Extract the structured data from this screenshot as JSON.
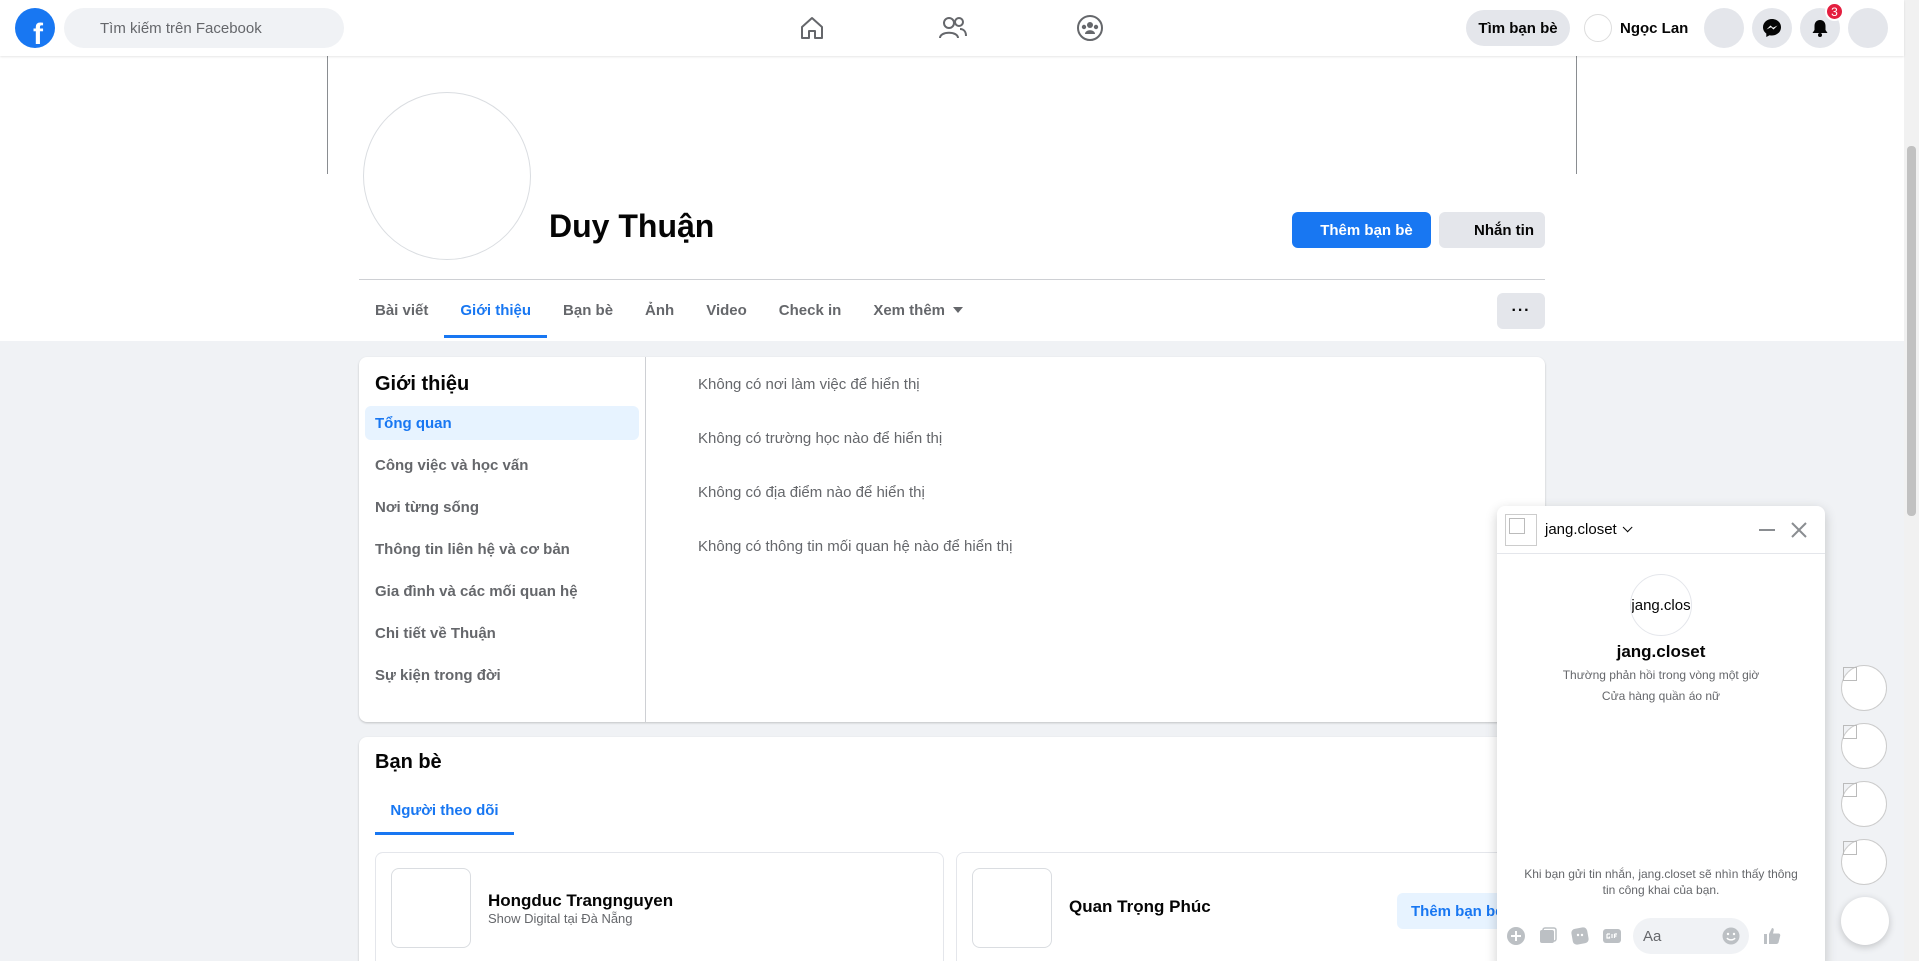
{
  "topbar": {
    "logo": "f",
    "search_placeholder": "Tìm kiếm trên Facebook",
    "nav_icons": [
      "home-icon",
      "friends-icon",
      "groups-icon"
    ],
    "find_friends_label": "Tìm bạn bè",
    "user_name": "Ngọc Lan",
    "notification_count": "3"
  },
  "profile": {
    "name": "Duy Thuận",
    "add_friend_label": "Thêm bạn bè",
    "message_label": "Nhắn tin",
    "tabs": [
      "Bài viết",
      "Giới thiệu",
      "Bạn bè",
      "Ảnh",
      "Video",
      "Check in",
      "Xem thêm"
    ],
    "active_tab": "Giới thiệu",
    "more_label": "···"
  },
  "about": {
    "title": "Giới thiệu",
    "menu": [
      "Tổng quan",
      "Công việc và học vấn",
      "Nơi từng sống",
      "Thông tin liên hệ và cơ bản",
      "Gia đình và các mối quan hệ",
      "Chi tiết về Thuận",
      "Sự kiện trong đời"
    ],
    "active_item": "Tổng quan",
    "lines": [
      "Không có nơi làm việc để hiển thị",
      "Không có trường học nào để hiển thị",
      "Không có địa điểm nào để hiển thị",
      "Không có thông tin mối quan hệ nào để hiển thị"
    ]
  },
  "friends": {
    "title": "Bạn bè",
    "tab": "Người theo dõi",
    "items": [
      {
        "name": "Hongduc Trangnguyen",
        "sub": "Show Digital tại Đà Nẵng"
      },
      {
        "name": "Quan Trọng Phúc",
        "button": "Thêm bạn bè"
      }
    ]
  },
  "chat": {
    "name": "jang.closet",
    "avatar_text": "jang.clos",
    "title": "jang.closet",
    "response": "Thường phản hồi trong vòng một giờ",
    "category": "Cửa hàng quần áo nữ",
    "note": "Khi bạn gửi tin nhắn, jang.closet sẽ nhìn thấy thông tin công khai của bạn.",
    "input_placeholder": "Aa"
  },
  "colors": {
    "brand": "#1877f2",
    "badge": "#e41e3f"
  }
}
